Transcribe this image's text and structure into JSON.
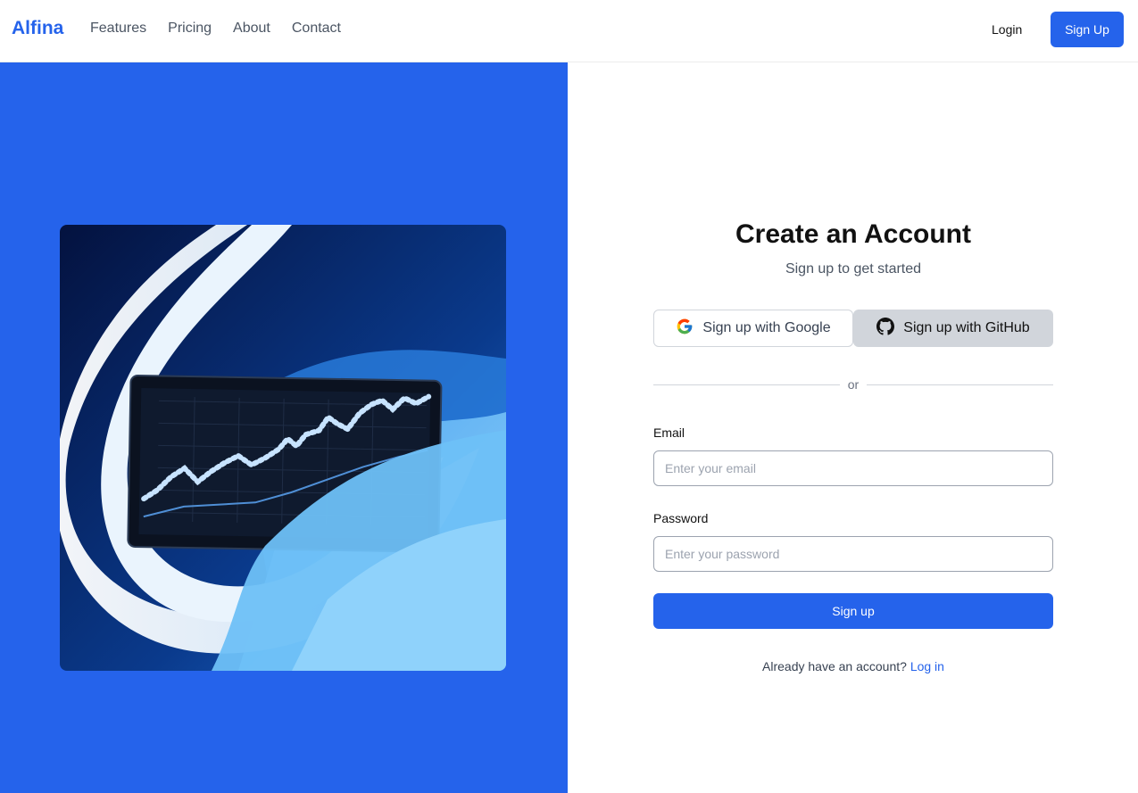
{
  "header": {
    "brand": "Alfina",
    "nav": [
      "Features",
      "Pricing",
      "About",
      "Contact"
    ],
    "login_label": "Login",
    "signup_label": "Sign Up"
  },
  "form": {
    "title": "Create an Account",
    "subtitle": "Sign up to get started",
    "google_label": "Sign up with Google",
    "github_label": "Sign up with GitHub",
    "divider_text": "or",
    "email_label": "Email",
    "email_placeholder": "Enter your email",
    "password_label": "Password",
    "password_placeholder": "Enter your password",
    "submit_label": "Sign up",
    "already_text": "Already have an account?",
    "login_link": "Log in"
  },
  "colors": {
    "accent": "#2563eb",
    "panel_bg": "#2563eb",
    "github_btn_bg": "#d1d5db"
  },
  "icons": {
    "google": "google-logo-icon",
    "github": "github-logo-icon"
  }
}
